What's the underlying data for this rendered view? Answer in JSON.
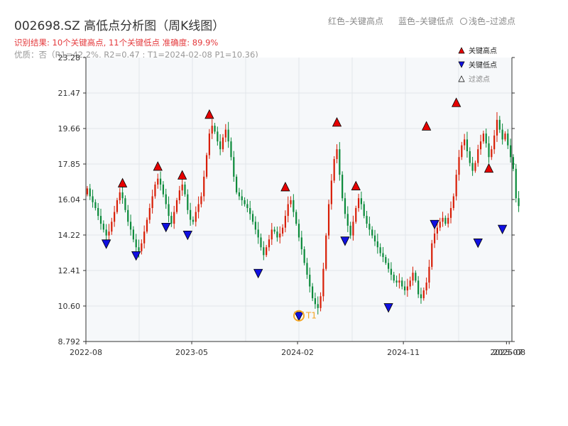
{
  "header": {
    "title": "002698.SZ 高低点分析图（周K线图）",
    "legend_text": [
      "红色–关键高点",
      "蓝色–关键低点",
      "浅色–过滤点"
    ],
    "result_line": "识别结果: 10个关键高点, 11个关键低点   准确度: 89.9%",
    "quality_line": "优质：否（R1=42.2%, R2=0.47 ; T1=2024-02-08 P1=10.36)"
  },
  "colors": {
    "up": "#d81e06",
    "down": "#0a8a3a",
    "high_marker": "#e60000",
    "low_marker": "#1010e0",
    "t1_marker": "#f5a623",
    "plot_bg": "#f6f8fa",
    "grid": "#e2e6ea",
    "axis": "#333333"
  },
  "chart_data": {
    "type": "candlestick",
    "y_ticks": [
      "8.792",
      "10.60",
      "12.41",
      "14.22",
      "16.04",
      "17.85",
      "19.66",
      "21.47",
      "23.28"
    ],
    "y_range": [
      8.792,
      23.28
    ],
    "x_ticks": [
      {
        "label": "2022-08",
        "week": 0
      },
      {
        "label": "2023-05",
        "week": 39
      },
      {
        "label": "2024-02",
        "week": 78
      },
      {
        "label": "2024-11",
        "week": 117
      },
      {
        "label": "2025-08",
        "week": 156
      },
      {
        "label": "2025-07",
        "week": 155
      }
    ],
    "x_range": [
      0,
      157
    ],
    "legend": [
      {
        "label": "关键高点",
        "marker": "triangle-up",
        "color": "#e60000"
      },
      {
        "label": "关键低点",
        "marker": "triangle-down",
        "color": "#1010e0"
      },
      {
        "label": "过滤点",
        "marker": "triangle-up-outline",
        "color": "#888888"
      }
    ],
    "closes": [
      16.6,
      16.2,
      15.9,
      15.6,
      15.2,
      14.8,
      14.5,
      14.2,
      14.4,
      14.9,
      15.4,
      16.0,
      16.4,
      16.1,
      15.5,
      14.9,
      14.5,
      14.0,
      13.6,
      13.4,
      13.8,
      14.4,
      15.0,
      15.6,
      16.2,
      16.8,
      17.1,
      16.8,
      16.3,
      15.8,
      15.2,
      14.8,
      15.4,
      16.0,
      16.5,
      16.8,
      16.3,
      15.5,
      15.0,
      14.9,
      15.4,
      15.8,
      16.2,
      17.2,
      18.3,
      19.4,
      19.8,
      19.5,
      19.0,
      18.6,
      19.2,
      19.6,
      19.0,
      18.2,
      17.2,
      16.4,
      16.2,
      16.0,
      15.8,
      15.6,
      15.3,
      14.9,
      14.5,
      14.1,
      13.6,
      13.2,
      13.6,
      14.0,
      14.5,
      14.4,
      14.1,
      14.3,
      14.6,
      15.2,
      15.8,
      16.0,
      15.4,
      14.8,
      14.1,
      13.5,
      12.8,
      12.2,
      11.6,
      11.0,
      10.7,
      10.5,
      11.1,
      12.5,
      14.2,
      15.8,
      17.0,
      18.1,
      18.6,
      17.3,
      16.1,
      15.3,
      14.7,
      14.2,
      14.9,
      15.6,
      16.1,
      15.8,
      15.2,
      14.8,
      14.5,
      14.2,
      13.9,
      13.6,
      13.3,
      13.1,
      12.8,
      12.5,
      12.2,
      11.9,
      11.8,
      11.9,
      11.6,
      11.4,
      11.6,
      11.9,
      12.3,
      11.9,
      11.2,
      11.0,
      11.4,
      11.8,
      12.6,
      13.8,
      14.3,
      14.6,
      14.9,
      15.1,
      14.8,
      15.1,
      15.6,
      16.2,
      17.3,
      18.2,
      18.8,
      19.1,
      18.5,
      17.9,
      17.5,
      17.9,
      18.6,
      19.0,
      19.4,
      18.9,
      18.2,
      18.6,
      19.3,
      20.1,
      19.6,
      19.1,
      19.4,
      18.8,
      18.2,
      17.6,
      16.1,
      15.7
    ],
    "key_highs": [
      {
        "week": 13,
        "price": 16.6
      },
      {
        "week": 26,
        "price": 17.45
      },
      {
        "week": 35,
        "price": 17.0
      },
      {
        "week": 45,
        "price": 20.1
      },
      {
        "week": 73,
        "price": 16.4
      },
      {
        "week": 92,
        "price": 19.7
      },
      {
        "week": 99,
        "price": 16.45
      },
      {
        "week": 125,
        "price": 19.5
      },
      {
        "week": 136,
        "price": 20.7
      },
      {
        "week": 148,
        "price": 17.35
      }
    ],
    "key_lows": [
      {
        "week": 7,
        "price": 14.05
      },
      {
        "week": 18,
        "price": 13.45
      },
      {
        "week": 29,
        "price": 14.9
      },
      {
        "week": 37,
        "price": 14.5
      },
      {
        "week": 63,
        "price": 12.55
      },
      {
        "week": 78,
        "price": 10.36
      },
      {
        "week": 95,
        "price": 14.2
      },
      {
        "week": 111,
        "price": 10.8
      },
      {
        "week": 128,
        "price": 15.05
      },
      {
        "week": 144,
        "price": 14.1
      },
      {
        "week": 153,
        "price": 14.8
      }
    ],
    "t1_marker": {
      "week": 78,
      "price": 10.36,
      "label": "T1"
    }
  }
}
